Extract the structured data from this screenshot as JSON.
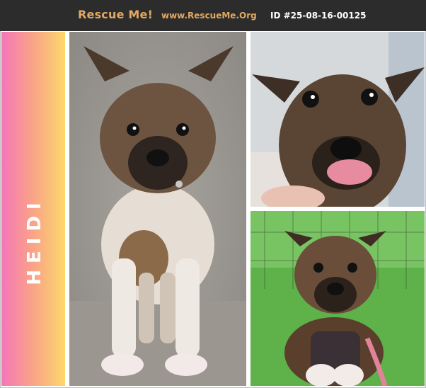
{
  "header": {
    "brand": "Rescue Me!",
    "site": "www.RescueMe.Org",
    "pet_id": "ID #25-08-16-00125"
  },
  "pet": {
    "name": "HEIDI"
  },
  "colors": {
    "header_bg": "#2c2c2c",
    "brand_orange": "#e3a862",
    "gradient_pink": "#f576b8",
    "gradient_yellow": "#fdd86b"
  },
  "photos": [
    {
      "subject": "puppy-standing-on-gravel"
    },
    {
      "subject": "puppy-closeup-tongue-out"
    },
    {
      "subject": "puppy-in-grass-with-harness"
    }
  ]
}
